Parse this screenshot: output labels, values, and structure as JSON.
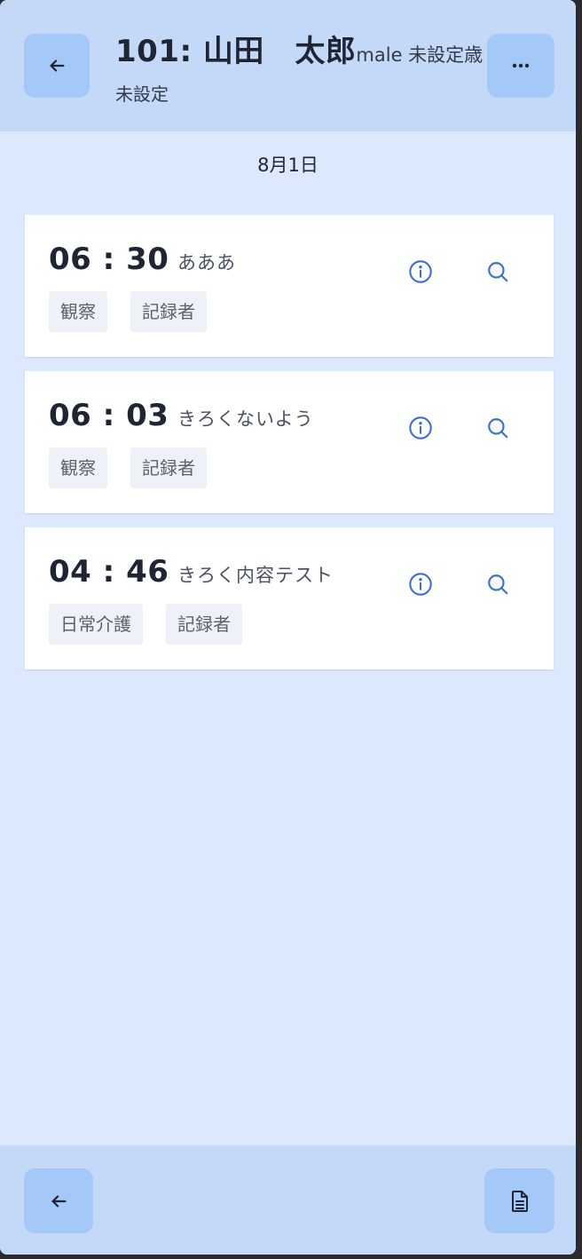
{
  "header": {
    "title": "101: 山田　太郎",
    "meta": "male 未設定歳",
    "subtitle": "未設定",
    "back_icon": "arrow-left-icon",
    "menu_icon": "more-horizontal-icon"
  },
  "date_label": "8月1日",
  "records": [
    {
      "time": "06 : 30",
      "content": "あああ",
      "tags": [
        "観察",
        "記録者"
      ]
    },
    {
      "time": "06 : 03",
      "content": "きろくないよう",
      "tags": [
        "観察",
        "記録者"
      ]
    },
    {
      "time": "04 : 46",
      "content": "きろく内容テスト",
      "tags": [
        "日常介護",
        "記録者"
      ]
    }
  ],
  "record_icons": [
    "info-icon",
    "search-icon"
  ],
  "footer": {
    "back_icon": "arrow-left-icon",
    "document_icon": "document-icon"
  },
  "colors": {
    "background": "#dce8fb",
    "header_bg": "#c4d9f8",
    "button_bg": "#a4c8f8",
    "icon_accent": "#3b6fd8",
    "card_bg": "#ffffff",
    "tag_bg": "#eef2f8"
  }
}
